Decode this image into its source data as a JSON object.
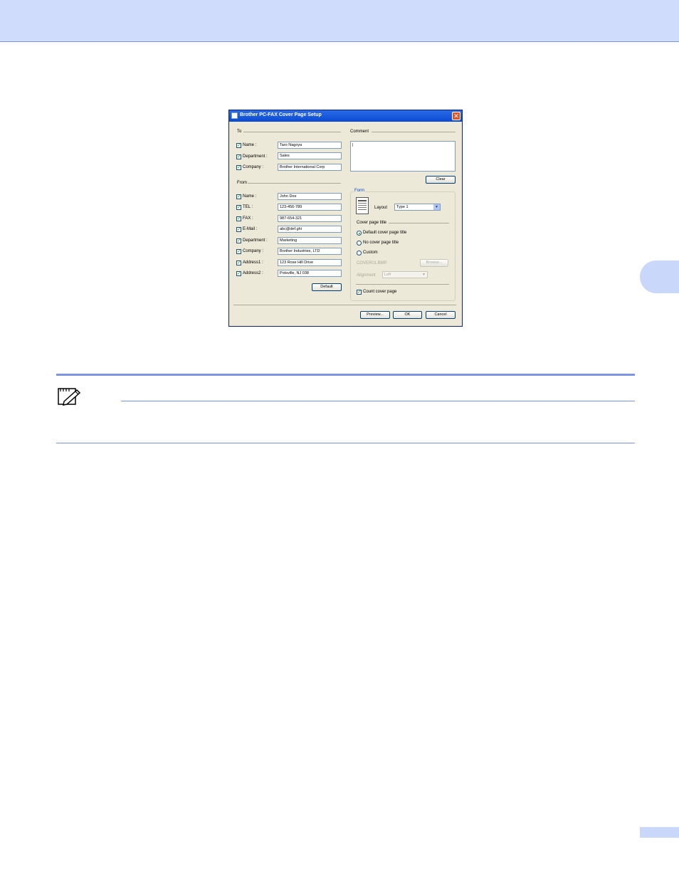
{
  "dialog": {
    "title": "Brother PC-FAX Cover Page Setup",
    "close_glyph": "✕",
    "check_glyph": "✓",
    "to": {
      "heading": "To",
      "fields": [
        {
          "label": "Name :",
          "value": "Taro Nagoya"
        },
        {
          "label": "Department :",
          "value": "Sales"
        },
        {
          "label": "Company :",
          "value": "Brother International Corp"
        }
      ]
    },
    "from": {
      "heading": "From",
      "fields": [
        {
          "label": "Name :",
          "value": "John Doe"
        },
        {
          "label": "TEL :",
          "value": "123-456-789"
        },
        {
          "label": "FAX :",
          "value": "987-654-321"
        },
        {
          "label": "E-Mail :",
          "value": "abc@def.ghi"
        },
        {
          "label": "Department :",
          "value": "Marketing"
        },
        {
          "label": "Company :",
          "value": "Brother Industries, LTD"
        },
        {
          "label": "Address1 :",
          "value": "123 Rose Hill Drive"
        },
        {
          "label": "Address2 :",
          "value": "Potsville, NJ 038"
        }
      ],
      "default_button": "Default"
    },
    "comment": {
      "heading": "Comment",
      "value": "|",
      "clear_button": "Clear"
    },
    "form": {
      "heading": "Form",
      "layout_label": "Layout",
      "layout_value": "Type 1",
      "cover_title_heading": "Cover page title",
      "options": [
        {
          "label": "Default cover page title",
          "selected": true
        },
        {
          "label": "No cover page title",
          "selected": false
        },
        {
          "label": "Custom",
          "selected": false
        }
      ],
      "file_label": "COVER01.BMP",
      "browse_button": "Browse...",
      "alignment_label": "Alignment",
      "alignment_value": "Left",
      "count_cover_page": "Count cover page"
    },
    "buttons": {
      "preview": "Preview...",
      "ok": "OK",
      "cancel": "Cancel"
    }
  }
}
